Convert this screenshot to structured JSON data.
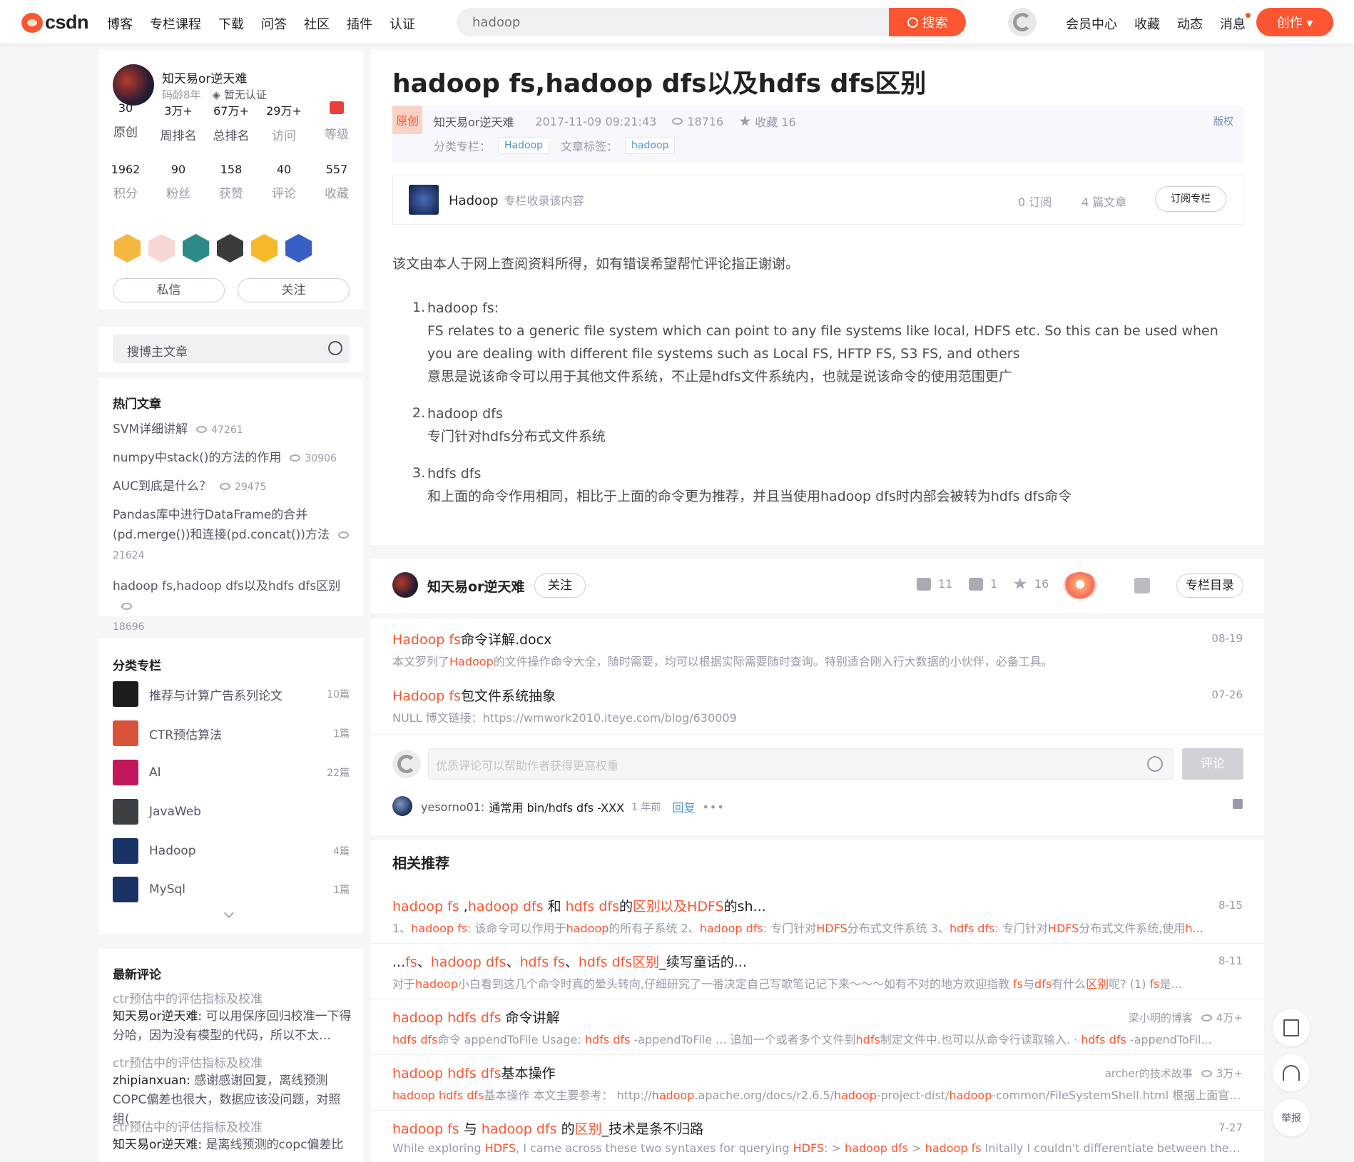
{
  "header": {
    "logo_text": "CSDN",
    "nav": [
      "博客",
      "专栏课程",
      "下载",
      "问答",
      "社区",
      "插件",
      "认证"
    ],
    "search_placeholder": "hadoop",
    "search_button": "搜索",
    "right_links": [
      "会员中心",
      "收藏",
      "动态",
      "消息"
    ],
    "create_button": "创作 ▾"
  },
  "profile": {
    "name": "知天易or逆天难",
    "age": "码龄8年",
    "cert": "暂无认证",
    "stats_row1": [
      {
        "n": "30",
        "l": "原创"
      },
      {
        "n": "3万+",
        "l": "周排名"
      },
      {
        "n": "67万+",
        "l": "总排名"
      },
      {
        "n": "29万+",
        "l": "访问"
      },
      {
        "n": "",
        "l": "等级"
      }
    ],
    "stats_row2": [
      {
        "n": "1962",
        "l": "积分"
      },
      {
        "n": "90",
        "l": "粉丝"
      },
      {
        "n": "158",
        "l": "获赞"
      },
      {
        "n": "40",
        "l": "评论"
      },
      {
        "n": "557",
        "l": "收藏"
      }
    ],
    "badge_colors": [
      "#f4b73f",
      "#f7d6d6",
      "#2d8a89",
      "#3b3b3b",
      "#f5b92b",
      "#3a5fc4"
    ],
    "message_button": "私信",
    "follow_button": "关注"
  },
  "blog_search": {
    "placeholder": "搜博主文章"
  },
  "hot": {
    "title": "热门文章",
    "items": [
      {
        "title": "SVM详细讲解",
        "views": "47261"
      },
      {
        "title": "numpy中stack()的方法的作用",
        "views": "30906"
      },
      {
        "title": "AUC到底是什么？",
        "views": "29475"
      },
      {
        "title": "Pandas库中进行DataFrame的合并(pd.merge())和连接(pd.concat())方法",
        "views": "21624"
      },
      {
        "title": "hadoop fs,hadoop dfs以及hdfs dfs区别",
        "views": "18696"
      }
    ]
  },
  "columns": {
    "title": "分类专栏",
    "items": [
      {
        "name": "推荐与计算广告系列论文",
        "count": "10篇",
        "color": "#1d1d1f"
      },
      {
        "name": "CTR预估算法",
        "count": "1篇",
        "color": "#d9533b"
      },
      {
        "name": "AI",
        "count": "22篇",
        "color": "#c2185b"
      },
      {
        "name": "JavaWeb",
        "count": "",
        "color": "#3c4043"
      },
      {
        "name": "Hadoop",
        "count": "4篇",
        "color": "#1a3366"
      },
      {
        "name": "MySql",
        "count": "1篇",
        "color": "#1a3366"
      }
    ]
  },
  "latest_comments": {
    "title": "最新评论",
    "items": [
      {
        "topic": "ctr预估中的评估指标及校准",
        "user": "知天易or逆天难:",
        "text": " 可以用保序回归校准一下得分哈，因为没有模型的代码，所以不太…"
      },
      {
        "topic": "ctr预估中的评估指标及校准",
        "user": "zhipianxuan:",
        "text": " 感谢感谢回复，离线预测COPC偏差也很大，数据应该没问题，对照组(…"
      },
      {
        "topic": "ctr预估中的评估指标及校准",
        "user": "知天易or逆天难:",
        "text": " 是离线预测的copc偏差比"
      }
    ]
  },
  "article": {
    "title": "hadoop fs,hadoop dfs以及hdfs dfs区别",
    "original": "原创",
    "author": "知天易or逆天难",
    "time": "2017-11-09 09:21:43",
    "views": "18716",
    "collect": "收藏 16",
    "copyright": "版权",
    "category_label": "分类专栏：",
    "category": "Hadoop",
    "tag_label": "文章标签：",
    "tag": "hadoop",
    "column": {
      "name": "Hadoop",
      "hint": "专栏收录该内容",
      "subs": "0 订阅",
      "articles": "4 篇文章",
      "subscribe_button": "订阅专栏"
    },
    "intro": "该文由本人于网上查阅资料所得，如有错误希望帮忙评论指正谢谢。",
    "list": [
      {
        "num": "1.",
        "head": "hadoop fs:",
        "lines": [
          "FS relates to a generic file system which can point to any file systems like local, HDFS etc. So this can be used when you are dealing with different file systems such as Local FS, HFTP FS, S3 FS, and others",
          "意思是说该命令可以用于其他文件系统，不止是hdfs文件系统内，也就是说该命令的使用范围更广"
        ]
      },
      {
        "num": "2.",
        "head": "hadoop dfs",
        "lines": [
          "专门针对hdfs分布式文件系统"
        ]
      },
      {
        "num": "3.",
        "head": "hdfs dfs",
        "lines": [
          "和上面的命令作用相同，相比于上面的命令更为推荐，并且当使用hadoop dfs时内部会被转为hdfs dfs命令"
        ]
      }
    ]
  },
  "toolbar": {
    "author": "知天易or逆天难",
    "follow": "关注",
    "likes": "11",
    "comments": "1",
    "stars": "16",
    "menu": "专栏目录"
  },
  "rel_top": [
    {
      "title_hl": "Hadoop fs",
      "title_rest": "命令详解.docx",
      "date": "08-19",
      "desc_a": "本文罗列了",
      "desc_hl": "Hadoop",
      "desc_b": "的文件操作命令大全，随时需要，均可以根据实际需要随时查询。特别适合刚入行大数据的小伙伴，必备工具。"
    },
    {
      "title_hl": "Hadoop fs",
      "title_rest": "包文件系统抽象",
      "date": "07-26",
      "desc_a": "NULL 博文链接：https://wmwork2010.iteye.com/blog/630009",
      "desc_hl": "",
      "desc_b": ""
    }
  ],
  "comment_box": {
    "placeholder": "优质评论可以帮助作者获得更高权重",
    "submit": "评论",
    "user": "yesorno01:",
    "text": "通常用 bin/hdfs dfs -XXX",
    "time": "1 年前",
    "reply": "回复",
    "more": "•••"
  },
  "related": {
    "title": "相关推荐",
    "items": [
      {
        "title": [
          [
            "hadoop fs",
            1
          ],
          [
            " ,",
            0
          ],
          [
            "hadoop dfs",
            1
          ],
          [
            " 和 ",
            0
          ],
          [
            "hdfs dfs",
            1
          ],
          [
            "的",
            0
          ],
          [
            "区别以及HDFS",
            1
          ],
          [
            "的sh...",
            0
          ]
        ],
        "date": "8-15",
        "author": "",
        "views": "",
        "desc": [
          [
            "1、",
            0
          ],
          [
            "hadoop fs",
            1
          ],
          [
            ": 该命令可以作用于",
            0
          ],
          [
            "hadoop",
            1
          ],
          [
            "的所有子系统 2、",
            0
          ],
          [
            "hadoop dfs",
            1
          ],
          [
            ": 专门针对",
            0
          ],
          [
            "HDFS",
            1
          ],
          [
            "分布式文件系统 3、",
            0
          ],
          [
            "hdfs dfs",
            1
          ],
          [
            ": 专门针对",
            0
          ],
          [
            "HDFS",
            1
          ],
          [
            "分布式文件系统,使用",
            0
          ],
          [
            "h...",
            1
          ]
        ]
      },
      {
        "title": [
          [
            "...",
            0
          ],
          [
            "fs",
            1
          ],
          [
            "、",
            0
          ],
          [
            "hadoop dfs",
            1
          ],
          [
            "、",
            0
          ],
          [
            "hdfs fs",
            1
          ],
          [
            "、",
            0
          ],
          [
            "hdfs dfs区别",
            1
          ],
          [
            "_续写童话的...",
            0
          ]
        ],
        "date": "8-11",
        "author": "",
        "views": "",
        "desc": [
          [
            "对于",
            0
          ],
          [
            "hadoop",
            1
          ],
          [
            "小白看到这几个命令时真的晕头转向,仔细研究了一番决定自己写歌笔记记下来～～～如有不对的地方欢迎指教 ",
            0
          ],
          [
            "fs",
            1
          ],
          [
            "与",
            0
          ],
          [
            "dfs",
            1
          ],
          [
            "有什么",
            0
          ],
          [
            "区别",
            1
          ],
          [
            "呢? (1) ",
            0
          ],
          [
            "fs",
            1
          ],
          [
            "是...",
            0
          ]
        ]
      },
      {
        "title": [
          [
            "hadoop hdfs dfs",
            1
          ],
          [
            " 命令讲解",
            0
          ]
        ],
        "date": "",
        "author": "梁小明的博客",
        "views": "4万+",
        "desc": [
          [
            "hdfs dfs",
            1
          ],
          [
            "命令 appendToFile Usage: ",
            0
          ],
          [
            "hdfs dfs",
            1
          ],
          [
            " -appendToFile  ...  追加一个或者多个文件到",
            0
          ],
          [
            "hdfs",
            1
          ],
          [
            "制定文件中.也可以从命令行读取输入. · ",
            0
          ],
          [
            "hdfs dfs",
            1
          ],
          [
            " -appendToFil...",
            0
          ]
        ]
      },
      {
        "title": [
          [
            "hadoop hdfs dfs",
            1
          ],
          [
            "基本操作",
            0
          ]
        ],
        "date": "",
        "author": "archer的技术故事",
        "views": "3万+",
        "desc": [
          [
            "hadoop hdfs dfs",
            1
          ],
          [
            "基本操作 本文主要参考：  http://",
            0
          ],
          [
            "hadoop",
            1
          ],
          [
            ".apache.org/docs/r2.6.5/",
            0
          ],
          [
            "hadoop",
            1
          ],
          [
            "-project-dist/",
            0
          ],
          [
            "hadoop",
            1
          ],
          [
            "-common/FileSystemShell.html 根据上面官方...",
            0
          ]
        ]
      },
      {
        "title": [
          [
            "hadoop fs",
            1
          ],
          [
            " 与 ",
            0
          ],
          [
            "hadoop dfs",
            1
          ],
          [
            " 的",
            0
          ],
          [
            "区别",
            1
          ],
          [
            "_技术是条不归路",
            0
          ]
        ],
        "date": "7-27",
        "author": "",
        "views": "",
        "desc": [
          [
            "While exploring ",
            0
          ],
          [
            "HDFS",
            1
          ],
          [
            ", I came across these two syntaxes for querying ",
            0
          ],
          [
            "HDFS",
            1
          ],
          [
            ": > ",
            0
          ],
          [
            "hadoop dfs",
            1
          ],
          [
            " > ",
            0
          ],
          [
            "hadoop fs",
            1
          ],
          [
            " Initally I couldn't differentiate between the two, a...",
            0
          ]
        ]
      }
    ]
  },
  "float_tools": {
    "report": "举报"
  }
}
